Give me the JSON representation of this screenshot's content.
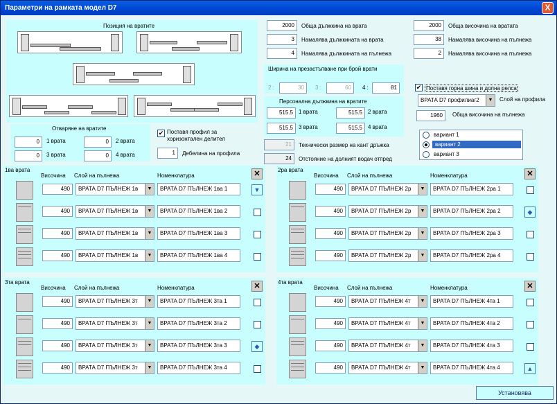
{
  "window": {
    "title": "Параметри на рамката модел D7",
    "close": "X"
  },
  "positions": {
    "title": "Позиция на вратите"
  },
  "door_totals": {
    "total_length_label": "Обща дължкина на врата",
    "total_length": "2000",
    "reduce_length_label": "Намалява дължкината на врата",
    "reduce_length": "3",
    "reduce_fill_label": "Намалява дължкината на пълнежа",
    "reduce_fill": "4",
    "total_height_label": "Обща височина на вратата",
    "total_height": "2000",
    "reduce_height_label": "Намалява височина на пълнежа",
    "reduce_height": "38",
    "reduce_fill_height_label": "Намалява височина на пълнежа",
    "reduce_fill_height": "2"
  },
  "overlap": {
    "title": "Ширина на презастъпване при брой врати",
    "l2": "2 :",
    "v2": "30",
    "l3": "3 :",
    "v3": "60",
    "l4": "4 :",
    "v4": "81"
  },
  "rail": {
    "label": "Поставя горна шина и долна релса",
    "checked": "✔",
    "profile": "ВРАТА D7 профилиаг2",
    "profile_label": "Слой на профила",
    "fill_height": "1960",
    "fill_height_label": "Обща височина на пълнежа"
  },
  "personal": {
    "title": "Персонална дължкина на вратите",
    "d1": "515.5",
    "d1_label": "1 врата",
    "d2": "515.5",
    "d2_label": "2 врата",
    "d3": "515.5",
    "d3_label": "3 врата",
    "d4": "515.5",
    "d4_label": "4 врата"
  },
  "technical": {
    "handle_val": "21",
    "handle_label": "Технически размер на кант дръжка",
    "dist_val": "24",
    "dist_label": "Отстояние на долният водач отпред"
  },
  "variants": {
    "v1": "вариант 1",
    "v2": "вариант 2",
    "v3": "вариант 3"
  },
  "opening": {
    "title": "Отваряне на вратите",
    "d1": "0",
    "d1_label": "1 врата",
    "d2": "0",
    "d2_label": "2 врата",
    "d3": "0",
    "d3_label": "3 врата",
    "d4": "0",
    "d4_label": "4 врата"
  },
  "divider": {
    "label": "Поставя профил за хоризонтален делител",
    "checked": "✔",
    "thickness": "1",
    "thickness_label": "Дебелина на профила"
  },
  "headers": {
    "height": "Височина",
    "layer": "Слой на пълнежа",
    "nomen": "Номенклатура"
  },
  "doors": [
    {
      "title": "1ва врата",
      "rows": [
        {
          "h": "490",
          "layer": "ВРАТА D7 ПЪЛНЕЖ 1в",
          "nom": "ВРАТА D7 ПЪЛНЕЖ 1ва 1"
        },
        {
          "h": "490",
          "layer": "ВРАТА D7 ПЪЛНЕЖ 1в",
          "nom": "ВРАТА D7 ПЪЛНЕЖ 1ва 2"
        },
        {
          "h": "490",
          "layer": "ВРАТА D7 ПЪЛНЕЖ 1в",
          "nom": "ВРАТА D7 ПЪЛНЕЖ 1ва 3"
        },
        {
          "h": "490",
          "layer": "ВРАТА D7 ПЪЛНЕЖ 1в",
          "nom": "ВРАТА D7 ПЪЛНЕЖ 1ва 4"
        }
      ]
    },
    {
      "title": "2ра врата",
      "rows": [
        {
          "h": "490",
          "layer": "ВРАТА D7 ПЪЛНЕЖ 2р",
          "nom": "ВРАТА D7 ПЪЛНЕЖ 2ра 1"
        },
        {
          "h": "490",
          "layer": "ВРАТА D7 ПЪЛНЕЖ 2р",
          "nom": "ВРАТА D7 ПЪЛНЕЖ 2ра 2"
        },
        {
          "h": "490",
          "layer": "ВРАТА D7 ПЪЛНЕЖ 2р",
          "nom": "ВРАТА D7 ПЪЛНЕЖ 2ра 3"
        },
        {
          "h": "490",
          "layer": "ВРАТА D7 ПЪЛНЕЖ 2р",
          "nom": "ВРАТА D7 ПЪЛНЕЖ 2ра 4"
        }
      ]
    },
    {
      "title": "3та врата",
      "rows": [
        {
          "h": "490",
          "layer": "ВРАТА D7 ПЪЛНЕЖ 3т",
          "nom": "ВРАТА D7 ПЪЛНЕЖ 3та 1"
        },
        {
          "h": "490",
          "layer": "ВРАТА D7 ПЪЛНЕЖ 3т",
          "nom": "ВРАТА D7 ПЪЛНЕЖ 3та 2"
        },
        {
          "h": "490",
          "layer": "ВРАТА D7 ПЪЛНЕЖ 3т",
          "nom": "ВРАТА D7 ПЪЛНЕЖ 3та 3"
        },
        {
          "h": "490",
          "layer": "ВРАТА D7 ПЪЛНЕЖ 3т",
          "nom": "ВРАТА D7 ПЪЛНЕЖ 3та 4"
        }
      ]
    },
    {
      "title": "4та врата",
      "rows": [
        {
          "h": "490",
          "layer": "ВРАТА D7 ПЪЛНЕЖ 4т",
          "nom": "ВРАТА D7 ПЪЛНЕЖ 4та 1"
        },
        {
          "h": "490",
          "layer": "ВРАТА D7 ПЪЛНЕЖ 4т",
          "nom": "ВРАТА D7 ПЪЛНЕЖ 4та 2"
        },
        {
          "h": "490",
          "layer": "ВРАТА D7 ПЪЛНЕЖ 4т",
          "nom": "ВРАТА D7 ПЪЛНЕЖ 4та 3"
        },
        {
          "h": "490",
          "layer": "ВРАТА D7 ПЪЛНЕЖ 4т",
          "nom": "ВРАТА D7 ПЪЛНЕЖ 4та 4"
        }
      ]
    }
  ],
  "set_button": "Установява"
}
